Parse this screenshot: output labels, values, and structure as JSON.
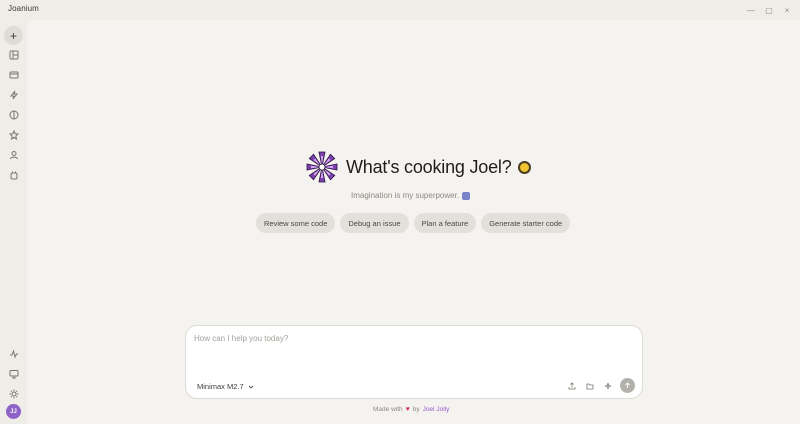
{
  "app": {
    "title": "Joanium"
  },
  "window_controls": {
    "minimize": "—",
    "maximize": "▢",
    "close": "×"
  },
  "sidebar": {
    "new_chat": "+",
    "items": [
      {
        "icon": "library-icon"
      },
      {
        "icon": "projects-icon"
      },
      {
        "icon": "automations-icon"
      },
      {
        "icon": "skills-icon"
      },
      {
        "icon": "favorites-icon"
      },
      {
        "icon": "agents-icon"
      },
      {
        "icon": "connectors-icon"
      }
    ],
    "bottom_items": [
      {
        "icon": "activity-icon"
      },
      {
        "icon": "display-icon"
      },
      {
        "icon": "theme-icon"
      }
    ],
    "avatar_initials": "JJ"
  },
  "hero": {
    "greeting": "What's cooking Joel?",
    "subtitle": "Imagination is my superpower."
  },
  "suggestions": [
    "Review some code",
    "Debug an issue",
    "Plan a feature",
    "Generate starter code"
  ],
  "composer": {
    "placeholder": "How can I help you today?",
    "model": "Minimax M2.7"
  },
  "footer": {
    "made_with": "Made with",
    "by": "by",
    "author": "Joel Jolly"
  },
  "colors": {
    "accent": "#9a5bd3",
    "heart": "#d92f6a",
    "avatar": "#8f62c8"
  }
}
